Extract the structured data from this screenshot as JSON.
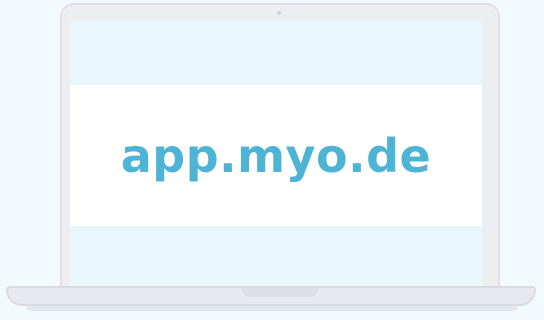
{
  "screen": {
    "url_text": "app.myo.de"
  },
  "colors": {
    "page_background": "#f2fafd",
    "laptop_frame": "#eceef2",
    "screen_background": "#e9f6fb",
    "band_background": "#ffffff",
    "accent_text": "#4eb4d6"
  },
  "icons": {
    "camera": "camera-dot-icon"
  }
}
